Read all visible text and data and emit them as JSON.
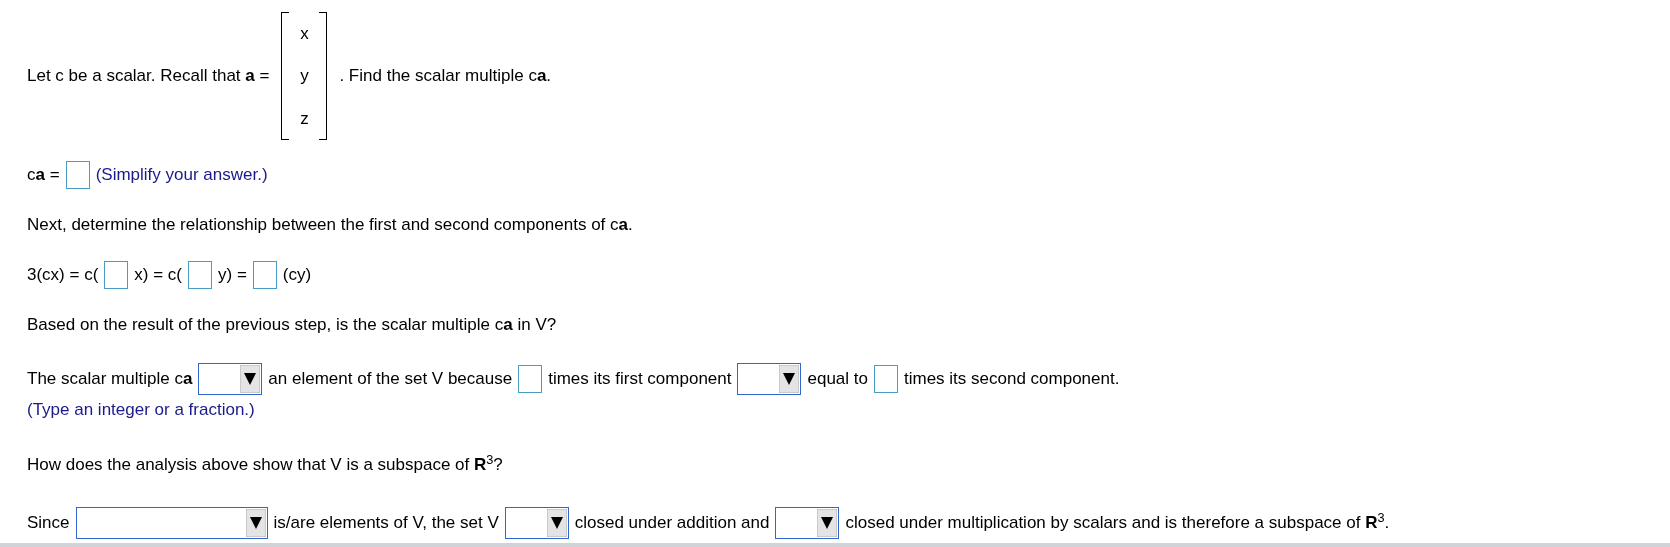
{
  "lines": [
    {
      "segments": [
        {
          "kind": "text",
          "text": "Let c be a scalar. Recall that **a** ="
        },
        {
          "kind": "matrix",
          "entries": [
            "x",
            "y",
            "z"
          ]
        },
        {
          "kind": "text",
          "text": ". Find the scalar multiple c**a**."
        }
      ]
    },
    {
      "segments": [
        {
          "kind": "text",
          "text": "c**a** ="
        },
        {
          "kind": "answer_box"
        },
        {
          "kind": "hint",
          "text": "(Simplify your answer.)"
        }
      ]
    },
    {
      "segments": [
        {
          "kind": "text",
          "text": "Next, determine the relationship between the first and second components of c**a**."
        }
      ]
    },
    {
      "segments": [
        {
          "kind": "text",
          "text": "3(cx) = c("
        },
        {
          "kind": "answer_box"
        },
        {
          "kind": "text",
          "text": "x) = c("
        },
        {
          "kind": "answer_box"
        },
        {
          "kind": "text",
          "text": "y) ="
        },
        {
          "kind": "answer_box"
        },
        {
          "kind": "text",
          "text": "(cy)"
        }
      ]
    },
    {
      "segments": [
        {
          "kind": "text",
          "text": "Based on the result of the previous step, is the scalar multiple c**a** in V?"
        }
      ]
    },
    {
      "segments": [
        {
          "kind": "text",
          "text": "The scalar multiple c**a**"
        },
        {
          "kind": "dropdown"
        },
        {
          "kind": "text",
          "text": "an element of the set V because"
        },
        {
          "kind": "answer_box"
        },
        {
          "kind": "text",
          "text": "times its first component"
        },
        {
          "kind": "dropdown"
        },
        {
          "kind": "text",
          "text": "equal to"
        },
        {
          "kind": "answer_box"
        },
        {
          "kind": "text",
          "text": "times its second component."
        }
      ]
    },
    {
      "segments": [
        {
          "kind": "hint",
          "text": "(Type an integer or a fraction.)"
        }
      ]
    },
    {
      "segments": [
        {
          "kind": "text",
          "text": "How does the analysis above show that V is a subspace of **R**$^{3}$?"
        }
      ]
    },
    {
      "segments": [
        {
          "kind": "text",
          "text": "Since"
        },
        {
          "kind": "wide_dropdown"
        },
        {
          "kind": "text",
          "text": "is/are elements of V, the set V"
        },
        {
          "kind": "dropdown"
        },
        {
          "kind": "text",
          "text": "closed under addition and"
        },
        {
          "kind": "dropdown"
        },
        {
          "kind": "text",
          "text": "closed under multiplication by scalars and is therefore a subspace of **R**$^{3}$."
        }
      ]
    }
  ]
}
